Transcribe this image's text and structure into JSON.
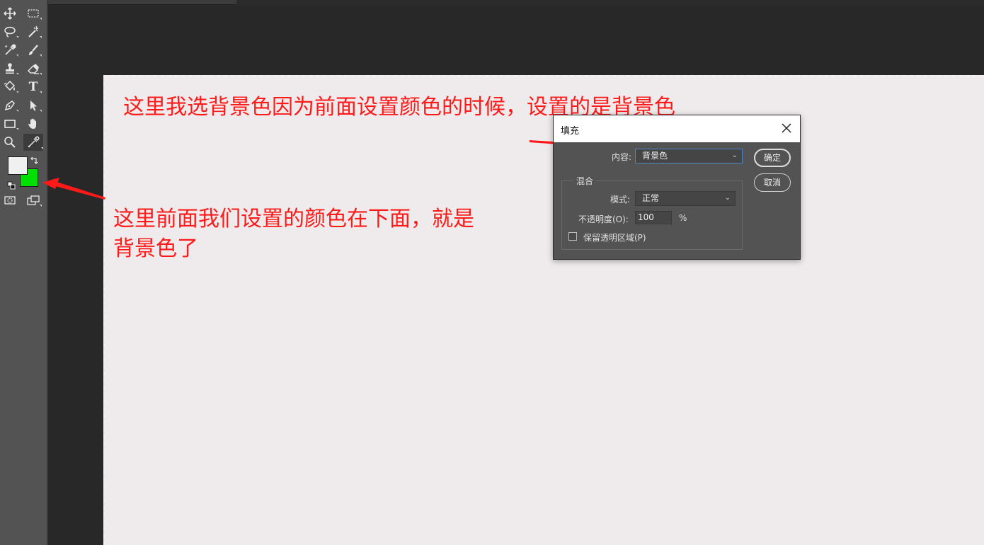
{
  "toolbar": {
    "tools": [
      {
        "name": "move-tool",
        "icon": "move-icon"
      },
      {
        "name": "marquee-tool",
        "icon": "rect-marquee-icon"
      },
      {
        "name": "lasso-tool",
        "icon": "lasso-icon"
      },
      {
        "name": "magic-wand-tool",
        "icon": "magic-wand-icon"
      },
      {
        "name": "eyedropper-tool",
        "icon": "eyedropper-icon"
      },
      {
        "name": "brush-tool",
        "icon": "brush-icon"
      },
      {
        "name": "stamp-tool",
        "icon": "stamp-icon"
      },
      {
        "name": "eraser-tool",
        "icon": "eraser-icon"
      },
      {
        "name": "paint-bucket-tool",
        "icon": "paint-bucket-icon"
      },
      {
        "name": "type-tool",
        "icon": "type-icon",
        "glyph": "T"
      },
      {
        "name": "pen-tool",
        "icon": "pen-icon"
      },
      {
        "name": "path-select-tool",
        "icon": "arrow-icon"
      },
      {
        "name": "rectangle-tool",
        "icon": "rectangle-icon"
      },
      {
        "name": "hand-tool",
        "icon": "hand-icon"
      },
      {
        "name": "zoom-tool",
        "icon": "zoom-icon"
      },
      {
        "name": "color-sampler-tool",
        "icon": "color-sampler-icon",
        "active": true
      }
    ],
    "foreground_color": "#f0f0f0",
    "background_color": "#00e000"
  },
  "annotations": {
    "top": "这里我选背景色因为前面设置颜色的时候，设置的是背景色",
    "left_line1": "这里前面我们设置的颜色在下面，就是",
    "left_line2": "背景色了",
    "color": "#ff1a1a"
  },
  "dialog": {
    "title": "填充",
    "content_label": "内容:",
    "content_value": "背景色",
    "blend_group_label": "混合",
    "mode_label": "模式:",
    "mode_value": "正常",
    "opacity_label": "不透明度(O):",
    "opacity_value": "100",
    "opacity_unit": "%",
    "preserve_transparency_label": "保留透明区域(P)",
    "preserve_transparency_checked": false,
    "ok_label": "确定",
    "cancel_label": "取消"
  },
  "colors": {
    "workspace": "#282828",
    "canvas": "#efeaeb",
    "panel": "#535353",
    "accent_focus": "#4a86c8"
  }
}
